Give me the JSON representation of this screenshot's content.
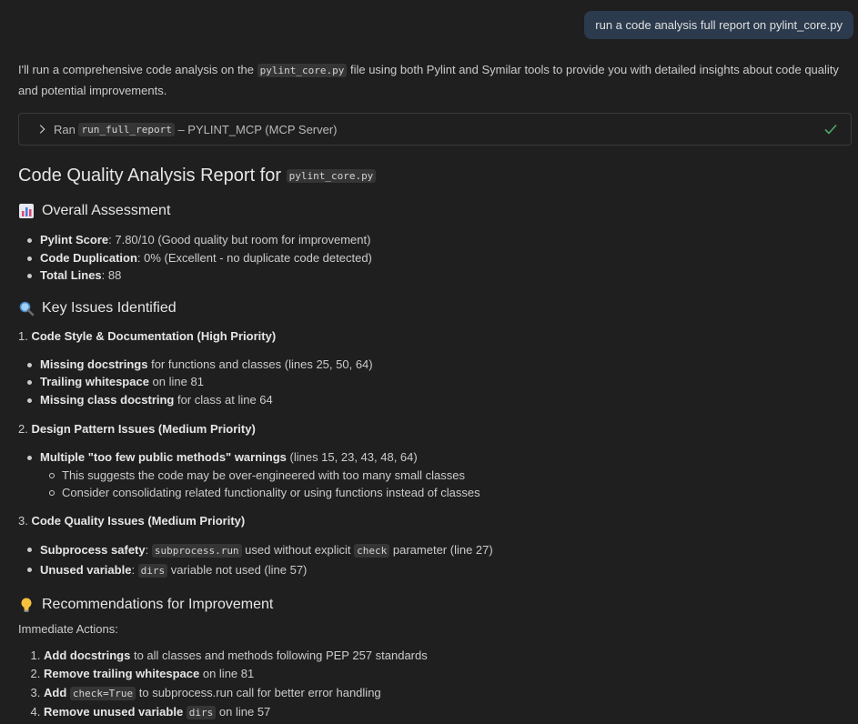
{
  "user_message": "run a code analysis full report on pylint_core.py",
  "intro": {
    "before": "I'll run a comprehensive code analysis on the ",
    "file": "pylint_core.py",
    "after": " file using both Pylint and Symilar tools to provide you with detailed insights about code quality and potential improvements."
  },
  "tool_call": {
    "ran_label": "Ran",
    "tool_name": "run_full_report",
    "server": "– PYLINT_MCP (MCP Server)",
    "status_icon": "check-icon"
  },
  "report": {
    "title": "Code Quality Analysis Report for ",
    "title_file": "pylint_core.py",
    "overall": {
      "heading": "Overall Assessment",
      "icon": "bar-chart-icon",
      "items": [
        {
          "label": "Pylint Score",
          "text": ": 7.80/10 (Good quality but room for improvement)"
        },
        {
          "label": "Code Duplication",
          "text": ": 0% (Excellent - no duplicate code detected)"
        },
        {
          "label": "Total Lines",
          "text": ": 88"
        }
      ]
    },
    "issues": {
      "heading": "Key Issues Identified",
      "icon": "magnifier-icon",
      "s1": {
        "num": "1. ",
        "title": "Code Style & Documentation (High Priority)",
        "items": [
          {
            "label": "Missing docstrings",
            "text": " for functions and classes (lines 25, 50, 64)"
          },
          {
            "label": "Trailing whitespace",
            "text": " on line 81"
          },
          {
            "label": "Missing class docstring",
            "text": " for class at line 64"
          }
        ]
      },
      "s2": {
        "num": "2. ",
        "title": "Design Pattern Issues (Medium Priority)",
        "item": {
          "label": "Multiple \"too few public methods\" warnings",
          "text": " (lines 15, 23, 43, 48, 64)"
        },
        "sub": [
          "This suggests the code may be over-engineered with too many small classes",
          "Consider consolidating related functionality or using functions instead of classes"
        ]
      },
      "s3": {
        "num": "3. ",
        "title": "Code Quality Issues (Medium Priority)",
        "items": [
          {
            "label": "Subprocess safety",
            "pre": ": ",
            "code": "subprocess.run",
            "text": " used without explicit ",
            "code2": "check",
            "text2": " parameter (line 27)"
          },
          {
            "label": "Unused variable",
            "pre": ": ",
            "code": "dirs",
            "text": " variable not used (line 57)"
          }
        ]
      }
    },
    "recommendations": {
      "heading": "Recommendations for Improvement",
      "icon": "lightbulb-icon",
      "subheading": "Immediate Actions:",
      "items": [
        {
          "label": "Add docstrings",
          "text": " to all classes and methods following PEP 257 standards"
        },
        {
          "label": "Remove trailing whitespace",
          "text": " on line 81"
        },
        {
          "label": "Add ",
          "code": "check=True",
          "text": " to subprocess.run call for better error handling"
        },
        {
          "label": "Remove unused variable",
          "code": "dirs",
          "text": " on line 57"
        }
      ]
    }
  }
}
